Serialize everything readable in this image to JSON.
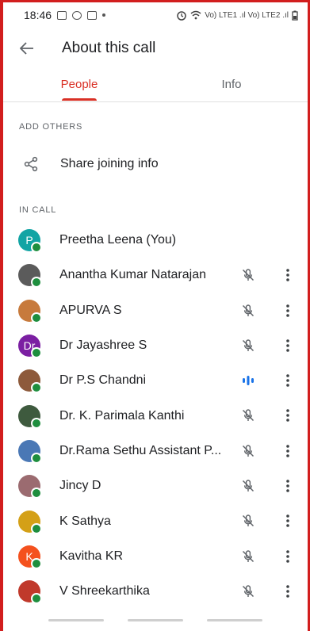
{
  "status_bar": {
    "time": "18:46",
    "network_text": "Vo) LTE1 .ıl Vo) LTE2 .ıl"
  },
  "app_bar": {
    "title": "About this call"
  },
  "tabs": [
    {
      "label": "People",
      "active": true
    },
    {
      "label": "Info",
      "active": false
    }
  ],
  "sections": {
    "add_others": "ADD OTHERS",
    "in_call": "IN CALL"
  },
  "share": {
    "label": "Share joining info"
  },
  "participants": [
    {
      "name": "Preetha Leena (You)",
      "avatar_letter": "P",
      "avatar_color": "#12a4a4",
      "mic": "none"
    },
    {
      "name": "Anantha Kumar Natarajan",
      "avatar_letter": "",
      "avatar_color": "#5b5b5b",
      "mic": "muted"
    },
    {
      "name": "APURVA S",
      "avatar_letter": "",
      "avatar_color": "#c77a3c",
      "mic": "muted"
    },
    {
      "name": "Dr Jayashree S",
      "avatar_letter": "Dr",
      "avatar_color": "#7b1fa2",
      "mic": "muted"
    },
    {
      "name": "Dr P.S Chandni",
      "avatar_letter": "",
      "avatar_color": "#8d5a3b",
      "mic": "speaking"
    },
    {
      "name": "Dr. K. Parimala Kanthi",
      "avatar_letter": "",
      "avatar_color": "#3e5a3e",
      "mic": "muted"
    },
    {
      "name": "Dr.Rama Sethu Assistant P...",
      "avatar_letter": "",
      "avatar_color": "#4a78b5",
      "mic": "muted"
    },
    {
      "name": "Jincy D",
      "avatar_letter": "",
      "avatar_color": "#9b6b70",
      "mic": "muted"
    },
    {
      "name": "K Sathya",
      "avatar_letter": "",
      "avatar_color": "#d4a017",
      "mic": "muted"
    },
    {
      "name": "Kavitha KR",
      "avatar_letter": "K",
      "avatar_color": "#f4511e",
      "mic": "muted"
    },
    {
      "name": "V Shreekarthika",
      "avatar_letter": "",
      "avatar_color": "#c0392b",
      "mic": "muted"
    }
  ],
  "colors": {
    "accent": "#d93025",
    "presence": "#1e8e3e",
    "speaking": "#1a73e8"
  }
}
